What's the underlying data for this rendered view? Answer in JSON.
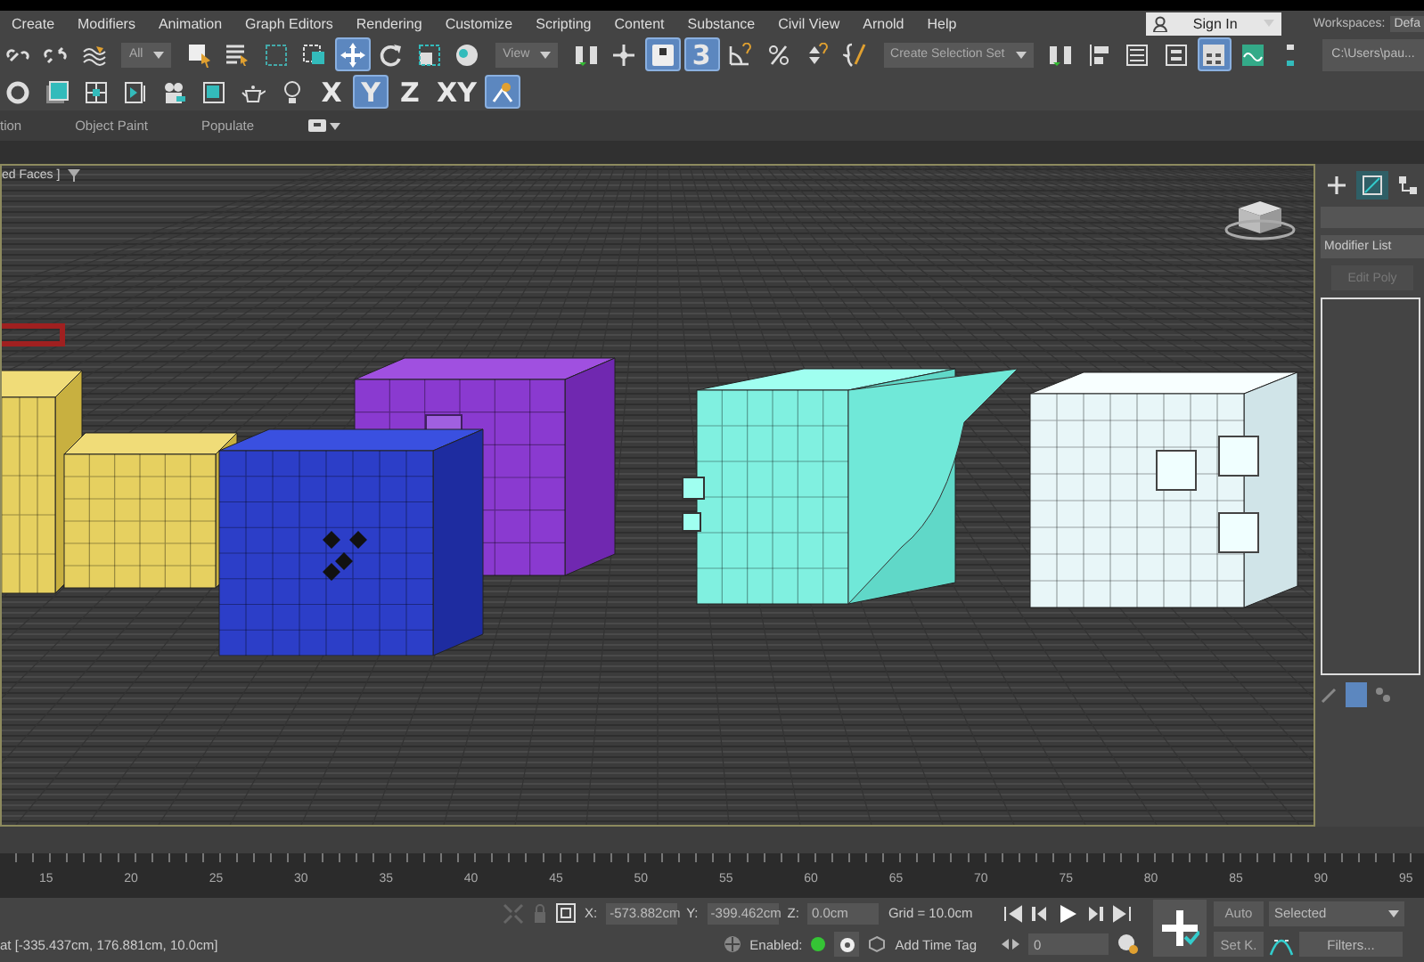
{
  "menu": [
    "Create",
    "Modifiers",
    "Animation",
    "Graph Editors",
    "Rendering",
    "Customize",
    "Scripting",
    "Content",
    "Substance",
    "Civil View",
    "Arnold",
    "Help"
  ],
  "sign_in": {
    "label": "Sign In"
  },
  "workspaces": {
    "label": "Workspaces:",
    "value": "Defa"
  },
  "toolbar_rows": [
    [
      {
        "kind": "icon",
        "selected": false
      },
      {
        "kind": "icon",
        "selected": false
      },
      {
        "kind": "icon",
        "selected": false
      },
      {
        "kind": "dropdown",
        "value": "All"
      },
      {
        "kind": "icon",
        "selected": false
      },
      {
        "kind": "icon",
        "selected": false
      },
      {
        "kind": "icon",
        "selected": false
      },
      {
        "kind": "icon",
        "selected": false
      },
      {
        "kind": "icon",
        "selected": true
      },
      {
        "kind": "icon",
        "selected": false
      },
      {
        "kind": "icon",
        "selected": false
      },
      {
        "kind": "icon",
        "selected": false
      },
      {
        "kind": "dropdown",
        "value": "View"
      },
      {
        "kind": "icon",
        "selected": false
      },
      {
        "kind": "icon",
        "selected": false
      },
      {
        "kind": "icon",
        "selected": true
      },
      {
        "kind": "text",
        "label": "3",
        "selected": true
      },
      {
        "kind": "icon",
        "selected": false
      },
      {
        "kind": "icon",
        "selected": false
      },
      {
        "kind": "icon",
        "selected": false
      },
      {
        "kind": "icon",
        "selected": false
      },
      {
        "kind": "dropdown",
        "value": "Create Selection Set"
      },
      {
        "kind": "icon",
        "selected": false
      },
      {
        "kind": "icon",
        "selected": false
      },
      {
        "kind": "icon",
        "selected": false
      },
      {
        "kind": "icon",
        "selected": false
      },
      {
        "kind": "icon",
        "selected": true
      },
      {
        "kind": "icon",
        "selected": false
      },
      {
        "kind": "icon",
        "selected": false
      },
      {
        "kind": "path",
        "value": "C:\\Users\\pau..."
      }
    ],
    [
      {
        "kind": "icon",
        "selected": false
      },
      {
        "kind": "icon",
        "selected": false
      },
      {
        "kind": "icon",
        "selected": false
      },
      {
        "kind": "icon",
        "selected": false
      },
      {
        "kind": "icon",
        "selected": false
      },
      {
        "kind": "icon",
        "selected": false
      },
      {
        "kind": "icon",
        "selected": false
      },
      {
        "kind": "icon",
        "selected": false
      },
      {
        "kind": "text",
        "label": "X",
        "selected": false
      },
      {
        "kind": "text",
        "label": "Y",
        "selected": true
      },
      {
        "kind": "text",
        "label": "Z",
        "selected": false
      },
      {
        "kind": "text",
        "label": "XY",
        "selected": false
      },
      {
        "kind": "icon",
        "selected": true
      }
    ]
  ],
  "ribbon_tabs": [
    "tion",
    "Object Paint",
    "Populate"
  ],
  "viewport": {
    "label": "ed Faces ]"
  },
  "command_panel": {
    "tabs": [
      {
        "selected": false
      },
      {
        "selected": true
      },
      {
        "selected": false
      }
    ],
    "modifier_list": "Modifier List",
    "button": "Edit Poly"
  },
  "timeline": {
    "ticks": [
      "15",
      "20",
      "25",
      "30",
      "35",
      "40",
      "45",
      "50",
      "55",
      "60",
      "65",
      "70",
      "75",
      "80",
      "85",
      "90",
      "95"
    ]
  },
  "status": {
    "prompt": "at [-335.437cm, 176.881cm, 10.0cm]",
    "coords": [
      {
        "label": "X:",
        "value": "-573.882cm"
      },
      {
        "label": "Y:",
        "value": "-399.462cm"
      },
      {
        "label": "Z:",
        "value": "0.0cm"
      }
    ],
    "grid": "Grid = 10.0cm",
    "enabled_label": "Enabled:",
    "time_tags_enabled": true,
    "add_time_tag": "Add Time Tag",
    "frame": "0",
    "auto": "Auto",
    "key_mode": "Selected",
    "set_key": "Set K.",
    "filters": "Filters..."
  }
}
